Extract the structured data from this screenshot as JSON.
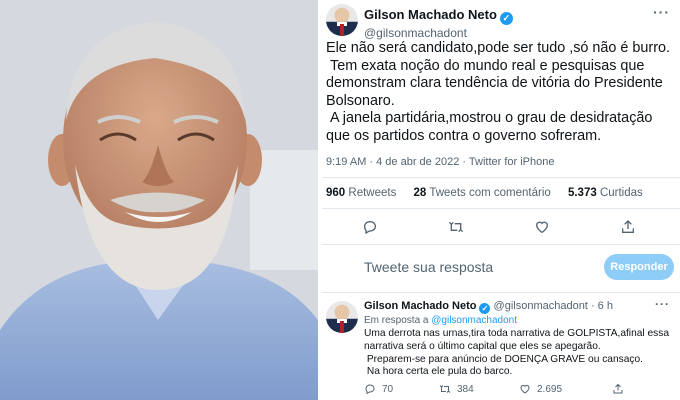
{
  "photo": {
    "description_icon": "portrait-photo"
  },
  "tweet": {
    "author_name": "Gilson Machado Neto",
    "handle": "@gilsonmachadont",
    "verified_icon": "verified-badge-icon",
    "more_icon": "more-icon",
    "text": "Ele não será candidato,pode ser tudo ,só não é burro.\n Tem exata noção do mundo real e pesquisas que demonstram clara tendência de vitória do Presidente Bolsonaro.\n A janela partidária,mostrou o grau de desidratação que os partidos contra o governo sofreram.",
    "timestamp": "9:19 AM · 4 de abr de 2022 · Twitter for iPhone",
    "retweets_count": "960",
    "retweets_label": "Retweets",
    "quotes_count": "28",
    "quotes_label": "Tweets com comentário",
    "likes_count": "5.373",
    "likes_label": "Curtidas",
    "actions": [
      "reply-icon",
      "retweet-icon",
      "like-icon",
      "share-icon"
    ]
  },
  "reply_composer": {
    "placeholder": "Tweete sua resposta",
    "button_label": "Responder"
  },
  "reply_tweet": {
    "author_name": "Gilson Machado Neto",
    "handle": "@gilsonmachadont",
    "time": "· 6 h",
    "reply_prefix": "Em resposta a ",
    "reply_handle": "@gilsonmachadont",
    "text": "Uma derrota nas urnas,tira toda narrativa de GOLPISTA,afinal essa narrativa será o último capital que eles se apegarão.\n Preparem-se para anúncio de DOENÇA GRAVE ou cansaço.\n Na hora certa ele pula do barco.",
    "reply_count": "70",
    "retweet_count": "384",
    "like_count": "2.695"
  },
  "colors": {
    "accent": "#1d9bf0",
    "button_disabled": "#8ecdf7",
    "muted": "#536471"
  }
}
